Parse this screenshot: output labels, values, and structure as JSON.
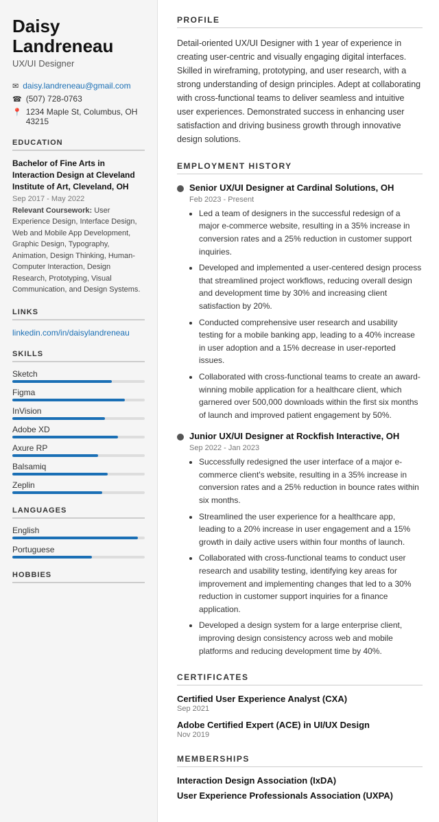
{
  "sidebar": {
    "name": "Daisy\nLandreneau",
    "name_line1": "Daisy",
    "name_line2": "Landreneau",
    "job_title": "UX/UI Designer",
    "contact": {
      "email": "daisy.landreneau@gmail.com",
      "phone": "(507) 728-0763",
      "address": "1234 Maple St, Columbus, OH 43215"
    },
    "education_section": "EDUCATION",
    "education_degree": "Bachelor of Fine Arts in Interaction Design at Cleveland Institute of Art, Cleveland, OH",
    "education_dates": "Sep 2017 - May 2022",
    "education_coursework_label": "Relevant Coursework:",
    "education_coursework": "User Experience Design, Interface Design, Web and Mobile App Development, Graphic Design, Typography, Animation, Design Thinking, Human-Computer Interaction, Design Research, Prototyping, Visual Communication, and Design Systems.",
    "links_section": "LINKS",
    "linkedin": "linkedin.com/in/daisylandreneau",
    "skills_section": "SKILLS",
    "skills": [
      {
        "name": "Sketch",
        "pct": 75
      },
      {
        "name": "Figma",
        "pct": 85
      },
      {
        "name": "InVision",
        "pct": 70
      },
      {
        "name": "Adobe XD",
        "pct": 80
      },
      {
        "name": "Axure RP",
        "pct": 65
      },
      {
        "name": "Balsamiq",
        "pct": 72
      },
      {
        "name": "Zeplin",
        "pct": 68
      }
    ],
    "languages_section": "LANGUAGES",
    "languages": [
      {
        "name": "English",
        "pct": 95
      },
      {
        "name": "Portuguese",
        "pct": 60
      }
    ],
    "hobbies_section": "HOBBIES"
  },
  "main": {
    "profile_section": "PROFILE",
    "profile_text": "Detail-oriented UX/UI Designer with 1 year of experience in creating user-centric and visually engaging digital interfaces. Skilled in wireframing, prototyping, and user research, with a strong understanding of design principles. Adept at collaborating with cross-functional teams to deliver seamless and intuitive user experiences. Demonstrated success in enhancing user satisfaction and driving business growth through innovative design solutions.",
    "employment_section": "EMPLOYMENT HISTORY",
    "jobs": [
      {
        "title": "Senior UX/UI Designer at Cardinal Solutions, OH",
        "dates": "Feb 2023 - Present",
        "bullets": [
          "Led a team of designers in the successful redesign of a major e-commerce website, resulting in a 35% increase in conversion rates and a 25% reduction in customer support inquiries.",
          "Developed and implemented a user-centered design process that streamlined project workflows, reducing overall design and development time by 30% and increasing client satisfaction by 20%.",
          "Conducted comprehensive user research and usability testing for a mobile banking app, leading to a 40% increase in user adoption and a 15% decrease in user-reported issues.",
          "Collaborated with cross-functional teams to create an award-winning mobile application for a healthcare client, which garnered over 500,000 downloads within the first six months of launch and improved patient engagement by 50%."
        ]
      },
      {
        "title": "Junior UX/UI Designer at Rockfish Interactive, OH",
        "dates": "Sep 2022 - Jan 2023",
        "bullets": [
          "Successfully redesigned the user interface of a major e-commerce client's website, resulting in a 35% increase in conversion rates and a 25% reduction in bounce rates within six months.",
          "Streamlined the user experience for a healthcare app, leading to a 20% increase in user engagement and a 15% growth in daily active users within four months of launch.",
          "Collaborated with cross-functional teams to conduct user research and usability testing, identifying key areas for improvement and implementing changes that led to a 30% reduction in customer support inquiries for a finance application.",
          "Developed a design system for a large enterprise client, improving design consistency across web and mobile platforms and reducing development time by 40%."
        ]
      }
    ],
    "certificates_section": "CERTIFICATES",
    "certificates": [
      {
        "name": "Certified User Experience Analyst (CXA)",
        "date": "Sep 2021"
      },
      {
        "name": "Adobe Certified Expert (ACE) in UI/UX Design",
        "date": "Nov 2019"
      }
    ],
    "memberships_section": "MEMBERSHIPS",
    "memberships": [
      "Interaction Design Association (IxDA)",
      "User Experience Professionals Association (UXPA)"
    ]
  }
}
